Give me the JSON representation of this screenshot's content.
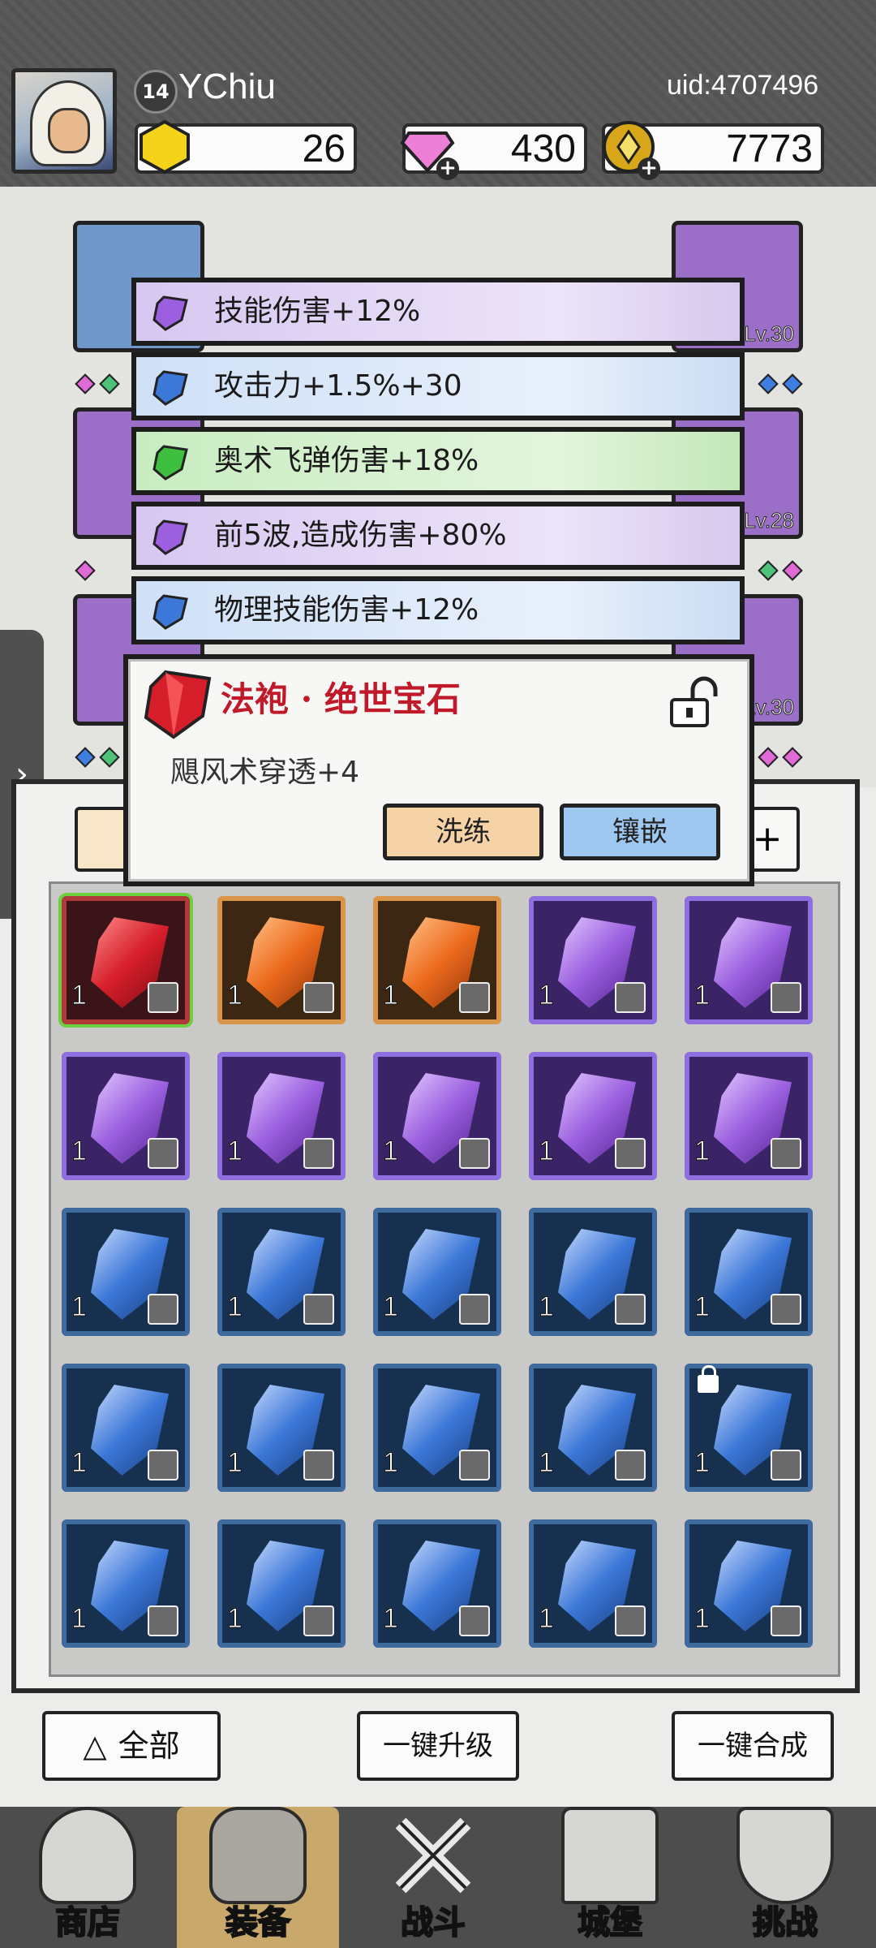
{
  "header": {
    "level": "14",
    "username": "YChiu",
    "uid": "uid:4707496",
    "currencies": [
      {
        "name": "gold-crystal",
        "value": "26",
        "color": "#f5d31b",
        "has_plus": false
      },
      {
        "name": "diamond",
        "value": "430",
        "color": "#ee7fd8",
        "has_plus": true
      },
      {
        "name": "coin",
        "value": "7773",
        "color": "#d8a619",
        "has_plus": true
      }
    ]
  },
  "equipment": {
    "slot_levels": {
      "right_1": "Lv.30",
      "right_2": "Lv.28",
      "right_3": "Lv.30"
    }
  },
  "affixes": [
    {
      "text": "技能伤害+12%",
      "color": "purple"
    },
    {
      "text": "攻击力+1.5%+30",
      "color": "blue"
    },
    {
      "text": "奥术飞弹伤害+18%",
      "color": "green"
    },
    {
      "text": "前5波,造成伤害+80%",
      "color": "purple"
    },
    {
      "text": "物理技能伤害+12%",
      "color": "blue"
    }
  ],
  "popup": {
    "title": "法袍 · 绝世宝石",
    "description": "飓风术穿透+4",
    "wash_label": "洗练",
    "inlay_label": "镶嵌"
  },
  "inventory": {
    "cells": [
      {
        "rarity": "red",
        "qty": "1"
      },
      {
        "rarity": "orange",
        "qty": "1"
      },
      {
        "rarity": "orange",
        "qty": "1"
      },
      {
        "rarity": "purple",
        "qty": "1"
      },
      {
        "rarity": "purple",
        "qty": "1"
      },
      {
        "rarity": "purple",
        "qty": "1"
      },
      {
        "rarity": "purple",
        "qty": "1"
      },
      {
        "rarity": "purple",
        "qty": "1"
      },
      {
        "rarity": "purple",
        "qty": "1"
      },
      {
        "rarity": "purple",
        "qty": "1"
      },
      {
        "rarity": "blue",
        "qty": "1"
      },
      {
        "rarity": "blue",
        "qty": "1"
      },
      {
        "rarity": "blue",
        "qty": "1"
      },
      {
        "rarity": "blue",
        "qty": "1"
      },
      {
        "rarity": "blue",
        "qty": "1"
      },
      {
        "rarity": "blue",
        "qty": "1"
      },
      {
        "rarity": "blue",
        "qty": "1"
      },
      {
        "rarity": "blue",
        "qty": "1"
      },
      {
        "rarity": "blue",
        "qty": "1"
      },
      {
        "rarity": "blue",
        "qty": "1",
        "locked": true
      },
      {
        "rarity": "blue",
        "qty": "1"
      },
      {
        "rarity": "blue",
        "qty": "1"
      },
      {
        "rarity": "blue",
        "qty": "1"
      },
      {
        "rarity": "blue",
        "qty": "1"
      },
      {
        "rarity": "blue",
        "qty": "1"
      }
    ]
  },
  "actions": {
    "all_label": "全部",
    "upgrade_all_label": "一键升级",
    "merge_all_label": "一键合成"
  },
  "nav": [
    {
      "label": "商店",
      "icon": "shop-icon"
    },
    {
      "label": "装备",
      "icon": "bag-icon",
      "active": true
    },
    {
      "label": "战斗",
      "icon": "swords-icon"
    },
    {
      "label": "城堡",
      "icon": "castle-icon"
    },
    {
      "label": "挑战",
      "icon": "shield-icon"
    }
  ]
}
